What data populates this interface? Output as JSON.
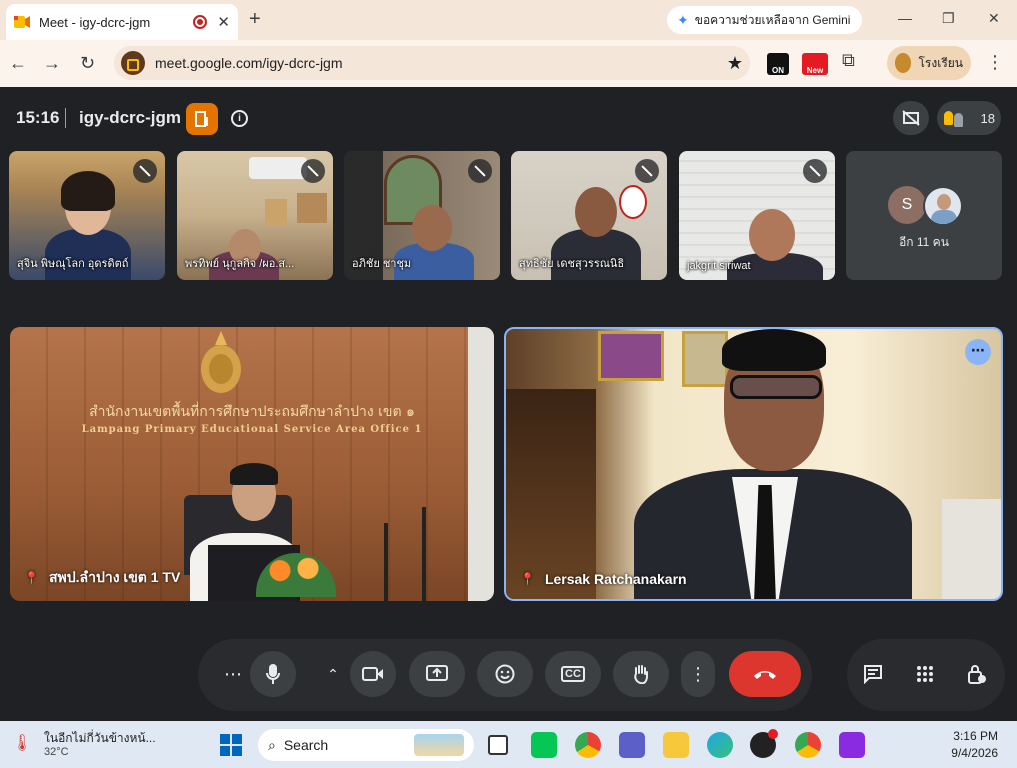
{
  "browser": {
    "tab_title": "Meet - igy-dcrc-jgm",
    "tab_close": "✕",
    "new_tab": "+",
    "gemini_label": "ขอความช่วยเหลือจาก Gemini",
    "url": "meet.google.com/igy-dcrc-jgm",
    "ext_on": "ON",
    "ext_new": "New",
    "profile_label": "โรงเรียน",
    "minimize": "—",
    "restore": "❐",
    "close": "✕"
  },
  "meet": {
    "time": "15:16",
    "meeting_code": "igy-dcrc-jgm",
    "participant_count": "18",
    "host_badge": "▮▯"
  },
  "thumbnails": [
    {
      "name": "สุจิน พิษณุโลก อุดรดิตถ์",
      "muted": true
    },
    {
      "name": "พรทิพย์ นุกูลกิจ /ผอ.ส...",
      "muted": true
    },
    {
      "name": "อภิชัย ชาชุม",
      "muted": true
    },
    {
      "name": "สุทธิชัย เดชสุวรรณนิธิ",
      "muted": true
    },
    {
      "name": "jakgrit siriwat",
      "muted": true
    }
  ],
  "more_tile": {
    "avatar_letter": "S",
    "label": "อีก 11 คน"
  },
  "main_tiles": [
    {
      "name": "สพป.ลำปาง เขต 1 TV",
      "sign_thai": "สำนักงานเขตพื้นที่การศึกษาประถมศึกษาลำปาง เขต ๑",
      "sign_english": "Lampang Primary Educational Service Area Office 1"
    },
    {
      "name": "Lersak Ratchanakarn"
    }
  ],
  "controls": {
    "more_audio": "⋯",
    "mic": "🎙",
    "expand": "⌃",
    "camera": "▭",
    "present": "⇪",
    "emoji": "☺",
    "captions": "CC",
    "hand": "✋",
    "more": "⋮",
    "hangup": "☎",
    "chat": "▤",
    "activities": "⠿",
    "host_controls": "🔒"
  },
  "taskbar": {
    "weather_text": "ในอีกไม่กี่วันข้างหน้...",
    "temperature": "32°C",
    "search_label": "Search",
    "time": "3:16 PM",
    "date": "9/4/2026"
  },
  "colors": {
    "accent_blue": "#8ab4f8",
    "hangup_red": "#dc362e",
    "host_orange": "#e37400",
    "meet_bg": "#202124"
  }
}
